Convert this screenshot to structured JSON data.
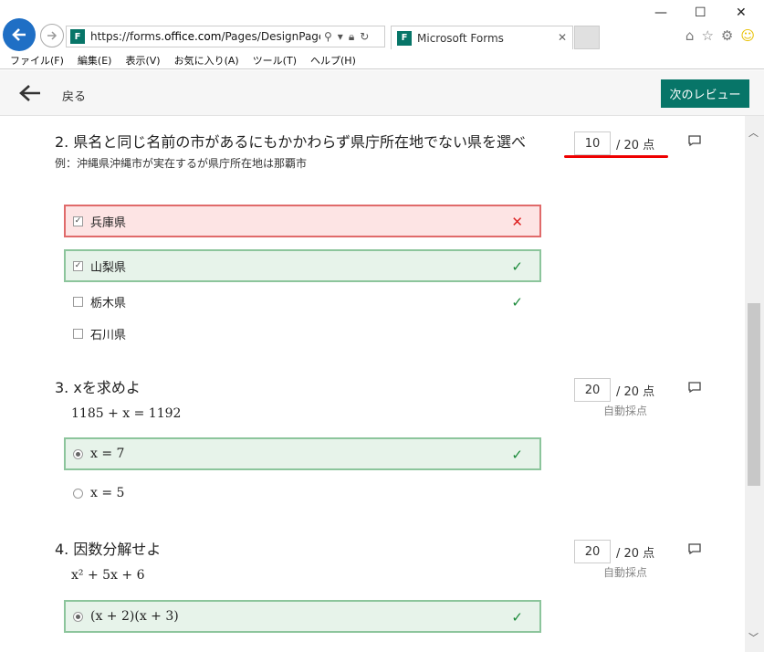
{
  "browser": {
    "url_prefix": "https://forms.",
    "url_domain": "office.com",
    "url_path": "/Pages/DesignPage.aspx",
    "tab_title": "Microsoft Forms",
    "favicon_text": "F",
    "menu": [
      "ファイル(F)",
      "編集(E)",
      "表示(V)",
      "お気に入り(A)",
      "ツール(T)",
      "ヘルプ(H)"
    ]
  },
  "header": {
    "back_label": "戻る",
    "next_review_label": "次のレビュー"
  },
  "questions": [
    {
      "number": "2.",
      "title": "県名と同じ名前の市があるにもかかわらず県庁所在地でない県を選べ",
      "subtitle": "例：沖縄県沖縄市が実在するが県庁所在地は那覇市",
      "score": "10",
      "max": "/ 20 点",
      "auto": "",
      "options": [
        {
          "label": "兵庫県",
          "checked": true,
          "state": "wrong"
        },
        {
          "label": "山梨県",
          "checked": true,
          "state": "right"
        },
        {
          "label": "栃木県",
          "checked": false,
          "state": "correct-unselected"
        },
        {
          "label": "石川県",
          "checked": false,
          "state": "plain"
        }
      ]
    },
    {
      "number": "3.",
      "title": "xを求めよ",
      "equation": "1185 + x = 1192",
      "score": "20",
      "max": "/ 20 点",
      "auto": "自動採点",
      "options": [
        {
          "label": "x = 7",
          "checked": true,
          "state": "right"
        },
        {
          "label": "x = 5",
          "checked": false,
          "state": "plain"
        }
      ]
    },
    {
      "number": "4.",
      "title": "因数分解せよ",
      "equation": "x² + 5x + 6",
      "score": "20",
      "max": "/ 20 点",
      "auto": "自動採点",
      "options": [
        {
          "label": "(x + 2)(x + 3)",
          "checked": true,
          "state": "right"
        }
      ]
    }
  ],
  "colors": {
    "brand": "#077568",
    "wrong_bg": "#fde4e4",
    "wrong_border": "#e06a6a",
    "right_bg": "#e7f3ea",
    "right_border": "#8cc59c",
    "check_green": "#1b8a3a",
    "cross_red": "#dd2222",
    "highlight_underline": "#ee0000"
  },
  "icons": {
    "back": "arrow-left-icon",
    "comment": "comment-icon",
    "wrong": "cross-icon",
    "right": "checkmark-icon"
  }
}
